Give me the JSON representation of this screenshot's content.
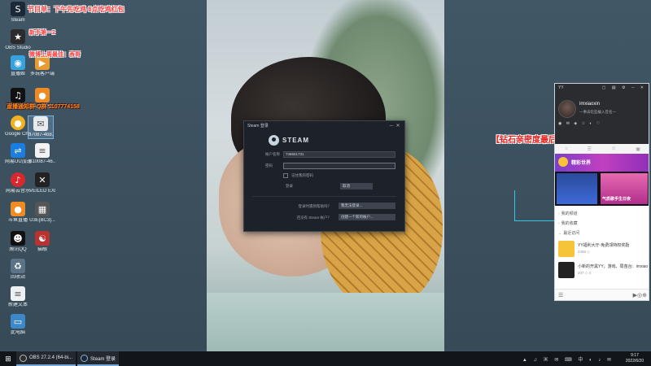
{
  "overlays": {
    "schedule": "节目单：下午先吃鸡 6点吃鸡红包",
    "newbie": "新手第一2",
    "fans": "微博上周最佳：表哥",
    "qq_group": "直播通知群 Q群 1107774158"
  },
  "desktop_icons": [
    {
      "label": "Steam",
      "glyph": "S",
      "color": "#1b2838"
    },
    {
      "label": "OBS Studio",
      "glyph": "★",
      "color": "#2b2b2b"
    },
    {
      "label": "直播姬",
      "glyph": "◉",
      "color": "#36a2e0"
    },
    {
      "label": "多玩客户端",
      "glyph": "▶",
      "color": "#e79b32"
    },
    {
      "label": "直播助手",
      "glyph": "♫",
      "color": "#111"
    },
    {
      "label": "Google Chrome",
      "glyph": "●",
      "color": "#f0b21f"
    },
    {
      "label": "37087-4b8...",
      "glyph": "✉",
      "color": "#e8ebee"
    },
    {
      "label": "网易UU加速器",
      "glyph": "⇌",
      "color": "#1a7de0"
    },
    {
      "label": "310087-46...",
      "glyph": "≡",
      "color": "#f3f3f3"
    },
    {
      "label": "网易云音乐",
      "glyph": "♪",
      "color": "#d9272e"
    },
    {
      "label": "VEILED EXPERTS",
      "glyph": "✕",
      "color": "#222"
    },
    {
      "label": "斗鱼直播",
      "glyph": "●",
      "color": "#f08b24"
    },
    {
      "label": "U3E[BC3]...",
      "glyph": "▦",
      "color": "#555"
    },
    {
      "label": "腾讯QQ",
      "glyph": "☻",
      "color": "#111"
    },
    {
      "label": "猫眼",
      "glyph": "☯",
      "color": "#b83232"
    },
    {
      "label": "回收站",
      "glyph": "🗑",
      "color": "#5a7386"
    },
    {
      "label": "新建文本",
      "glyph": "📄",
      "color": "#eef1f3"
    },
    {
      "label": "此电脑",
      "glyph": "💻",
      "color": "#3d88c9"
    }
  ],
  "steam": {
    "window_title": "Steam 登录",
    "logo_text": "STEAM",
    "account_label": "帐户名称",
    "account_value": "746651731",
    "password_label": "密码",
    "password_value": "",
    "remember_label": "记住我的密码",
    "login_label": "登录",
    "cancel_label": "取消",
    "help_q": "登录时遇到帮助吗？",
    "help_btn": "我无法登录...",
    "create_q": "还没有 Steam 帐户？",
    "create_btn": "创建一个新的帐户..."
  },
  "yy": {
    "brand": "YY",
    "window_buttons": "▢ ▤ ⚙ ─ ✕",
    "username": "imxiaoxin",
    "signature": "一事去吃些编入签名一",
    "toolbar": "◉ ✉ ◈ ☆ ◐ ♡",
    "tabs": [
      "⌂",
      "☰",
      "☺",
      "▣"
    ],
    "banner1_text": "精彩世界",
    "banner2_caption": "气质歌手生日夜",
    "section_recent": "我的频道",
    "section_fav": "我的收藏",
    "section_last": "最近访问",
    "items": [
      {
        "title": "YY福利大厅-免费领特权奖励",
        "meta": "2495 ◇"
      },
      {
        "title": "小新的开黑YY，游戏、局苗台：imxiao",
        "meta": "207 ◇ 4"
      }
    ],
    "bottom_icons": [
      "☰",
      "▶",
      "◎",
      "⊕"
    ]
  },
  "banner_red": "【钻石亲密度最后一张拉！】",
  "taskbar": {
    "start_glyph": "⊞",
    "tasks": [
      {
        "label": "OBS 27.2.4 (64-bi...",
        "color": "#2c2c2c"
      },
      {
        "label": "Steam 登录",
        "color": "#1b2838"
      }
    ],
    "tray": "▲ ♫ ▣ ✉ ⌨ 中 ◐ ♪ ✉",
    "time": "9:17",
    "date": "2022/6/20"
  }
}
